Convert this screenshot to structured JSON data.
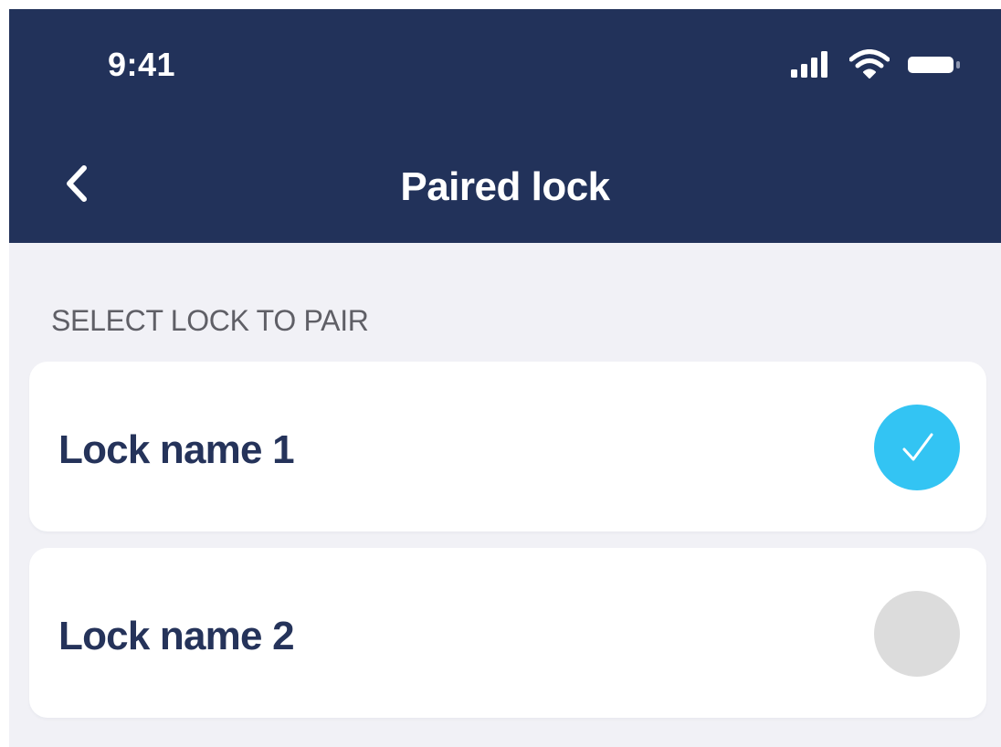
{
  "status_bar": {
    "time": "9:41",
    "icons": [
      "cellular-signal-icon",
      "wifi-icon",
      "battery-icon"
    ]
  },
  "nav": {
    "back_icon": "chevron-left-icon",
    "title": "Paired lock"
  },
  "section": {
    "header": "SELECT LOCK TO PAIR"
  },
  "locks": [
    {
      "name": "Lock name 1",
      "selected": true
    },
    {
      "name": "Lock name 2",
      "selected": false
    }
  ],
  "colors": {
    "header_bg": "#22325a",
    "page_bg": "#f1f1f6",
    "text_primary": "#25335a",
    "text_secondary": "#5f5f66",
    "accent": "#33c4f3",
    "radio_unselected": "#dcdcdc"
  }
}
